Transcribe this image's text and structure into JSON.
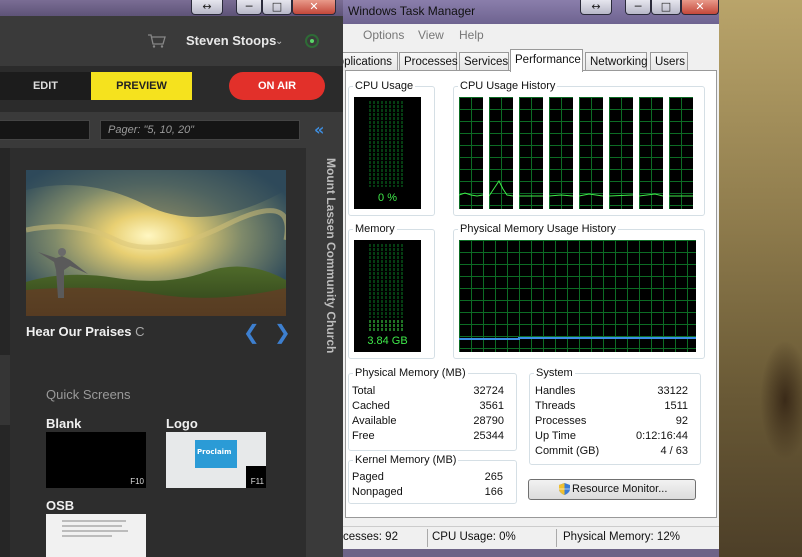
{
  "proclaim": {
    "user_name": "Steven Stoops",
    "mode_edit": "EDIT",
    "mode_preview": "PREVIEW",
    "on_air": "ON AIR",
    "pager_placeholder": "Pager: \"5, 10, 20\"",
    "church_name": "Mount Lassen Community Church",
    "slide_title": "Hear Our Praises",
    "slide_suffix": "C",
    "quick_screens_label": "Quick Screens",
    "quick_screens": [
      {
        "name": "Blank",
        "key": "F10"
      },
      {
        "name": "Logo",
        "key": "F11",
        "logo_text": "Proclaim"
      },
      {
        "name": "OSB"
      }
    ]
  },
  "taskmgr": {
    "title": "Windows Task Manager",
    "menu": [
      "Options",
      "View",
      "Help"
    ],
    "tabs": [
      "Applications",
      "Processes",
      "Services",
      "Performance",
      "Networking",
      "Users"
    ],
    "active_tab": "Performance",
    "cpu_usage_label": "CPU Usage",
    "cpu_usage_value": "0 %",
    "cpu_history_label": "CPU Usage History",
    "memory_label": "Memory",
    "memory_value": "3.84 GB",
    "memory_history_label": "Physical Memory Usage History",
    "physical_memory": {
      "title": "Physical Memory (MB)",
      "rows": [
        {
          "label": "Total",
          "value": "32724"
        },
        {
          "label": "Cached",
          "value": "3561"
        },
        {
          "label": "Available",
          "value": "28790"
        },
        {
          "label": "Free",
          "value": "25344"
        }
      ]
    },
    "kernel_memory": {
      "title": "Kernel Memory (MB)",
      "rows": [
        {
          "label": "Paged",
          "value": "265"
        },
        {
          "label": "Nonpaged",
          "value": "166"
        }
      ]
    },
    "system": {
      "title": "System",
      "rows": [
        {
          "label": "Handles",
          "value": "33122"
        },
        {
          "label": "Threads",
          "value": "1511"
        },
        {
          "label": "Processes",
          "value": "92"
        },
        {
          "label": "Up Time",
          "value": "0:12:16:44"
        },
        {
          "label": "Commit (GB)",
          "value": "4 / 63"
        }
      ]
    },
    "resource_monitor": "Resource Monitor...",
    "status": {
      "processes": "cesses: 92",
      "cpu": "CPU Usage: 0%",
      "memory": "Physical Memory: 12%"
    },
    "colors": {
      "graph_line": "#3fe94a",
      "grid": "#0c6b24",
      "memory_line": "#3b8ee6"
    }
  }
}
